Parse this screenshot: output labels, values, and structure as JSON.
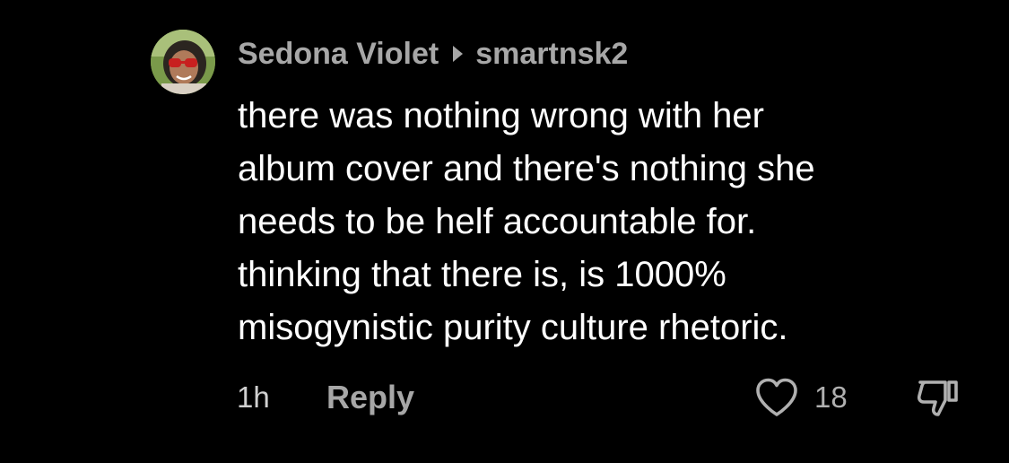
{
  "comment": {
    "author": "Sedona Violet",
    "reply_to": "smartnsk2",
    "text": "there was nothing wrong with her\nalbum cover and there's nothing she\nneeds to be helf accountable for.\nthinking that there is, is 1000%\nmisogynistic purity culture rhetoric.",
    "time": "1h",
    "reply_label": "Reply",
    "like_count": "18",
    "icons": {
      "avatar": "profile-photo",
      "reply_arrow": "triangle-right-icon",
      "like": "heart-outline-icon",
      "dislike": "thumbs-down-icon"
    }
  },
  "colors": {
    "background": "#000000",
    "text_primary": "#ffffff",
    "text_secondary": "#a7a7a7"
  }
}
